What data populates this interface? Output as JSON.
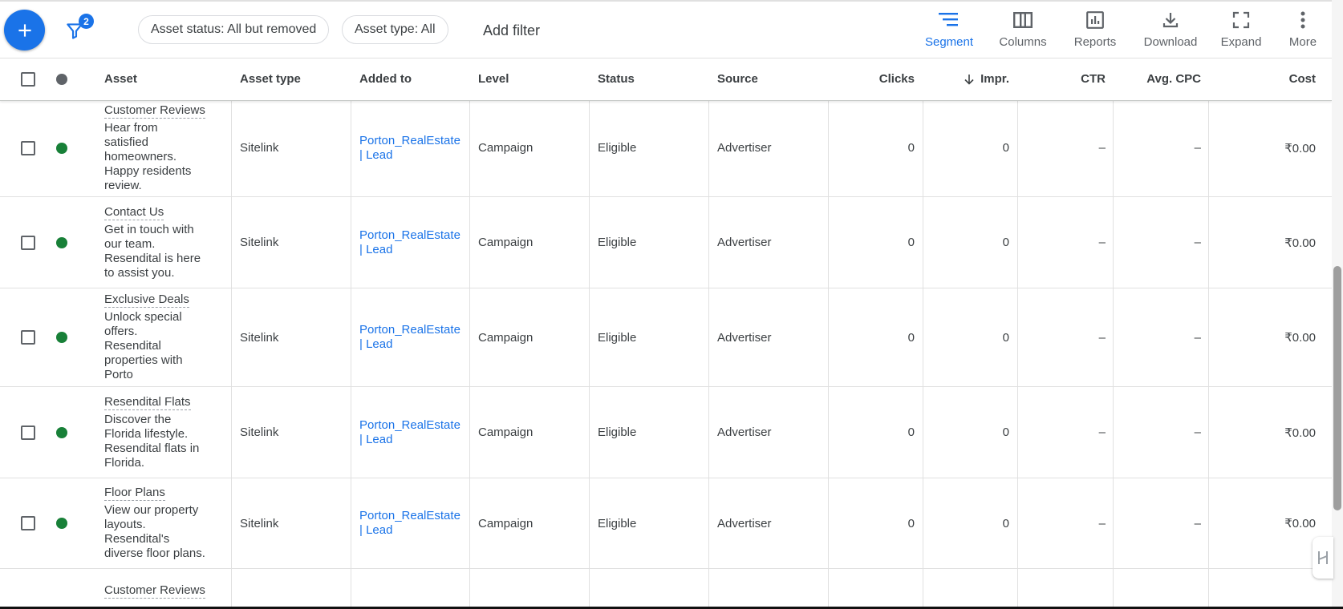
{
  "toolbar": {
    "filter_count": "2",
    "chips": [
      "Asset status: All but removed",
      "Asset type: All"
    ],
    "add_filter": "Add filter",
    "tools": [
      {
        "label": "Segment",
        "icon": "segment-icon"
      },
      {
        "label": "Columns",
        "icon": "columns-icon"
      },
      {
        "label": "Reports",
        "icon": "reports-icon"
      },
      {
        "label": "Download",
        "icon": "download-icon"
      },
      {
        "label": "Expand",
        "icon": "expand-icon"
      },
      {
        "label": "More",
        "icon": "more-vert-icon"
      }
    ]
  },
  "table": {
    "headers": {
      "asset": "Asset",
      "asset_type": "Asset type",
      "added_to": "Added to",
      "level": "Level",
      "status": "Status",
      "source": "Source",
      "clicks": "Clicks",
      "impr": "Impr.",
      "ctr": "CTR",
      "avg_cpc": "Avg. CPC",
      "cost": "Cost"
    },
    "sort": {
      "column": "impr",
      "direction": "descending"
    },
    "rows": [
      {
        "title": "Customer Reviews",
        "desc": [
          "Hear from",
          "satisfied",
          "homeowners.",
          "Happy residents",
          "review."
        ],
        "asset_type": "Sitelink",
        "added_to": [
          "Porton_RealEstate",
          "| Lead"
        ],
        "level": "Campaign",
        "status": "Eligible",
        "source": "Advertiser",
        "clicks": "0",
        "impr": "0",
        "ctr": "–",
        "avg_cpc": "–",
        "cost": "₹0.00"
      },
      {
        "title": "Contact Us",
        "desc": [
          "Get in touch with",
          "our team.",
          "Resendital is here",
          "to assist you."
        ],
        "asset_type": "Sitelink",
        "added_to": [
          "Porton_RealEstate",
          "| Lead"
        ],
        "level": "Campaign",
        "status": "Eligible",
        "source": "Advertiser",
        "clicks": "0",
        "impr": "0",
        "ctr": "–",
        "avg_cpc": "–",
        "cost": "₹0.00"
      },
      {
        "title": "Exclusive Deals",
        "desc": [
          "Unlock special",
          "offers.",
          "Resendital",
          "properties with",
          "Porto"
        ],
        "asset_type": "Sitelink",
        "added_to": [
          "Porton_RealEstate",
          "| Lead"
        ],
        "level": "Campaign",
        "status": "Eligible",
        "source": "Advertiser",
        "clicks": "0",
        "impr": "0",
        "ctr": "–",
        "avg_cpc": "–",
        "cost": "₹0.00"
      },
      {
        "title": "Resendital Flats",
        "desc": [
          "Discover the",
          "Florida lifestyle.",
          "Resendital flats in",
          "Florida."
        ],
        "asset_type": "Sitelink",
        "added_to": [
          "Porton_RealEstate",
          "| Lead"
        ],
        "level": "Campaign",
        "status": "Eligible",
        "source": "Advertiser",
        "clicks": "0",
        "impr": "0",
        "ctr": "–",
        "avg_cpc": "–",
        "cost": "₹0.00"
      },
      {
        "title": "Floor Plans",
        "desc": [
          "View our property",
          "layouts.",
          "Resendital's",
          "diverse floor plans."
        ],
        "asset_type": "Sitelink",
        "added_to": [
          "Porton_RealEstate",
          "| Lead"
        ],
        "level": "Campaign",
        "status": "Eligible",
        "source": "Advertiser",
        "clicks": "0",
        "impr": "0",
        "ctr": "–",
        "avg_cpc": "–",
        "cost": "₹0.00"
      },
      {
        "title": "Customer Reviews",
        "desc": [],
        "asset_type": "",
        "added_to": [],
        "level": "",
        "status": "",
        "source": "",
        "clicks": "",
        "impr": "",
        "ctr": "",
        "avg_cpc": "",
        "cost": ""
      }
    ]
  },
  "colors": {
    "accent": "#1a73e8",
    "status_eligible": "#188038",
    "header_status_dot": "#5f6368"
  }
}
